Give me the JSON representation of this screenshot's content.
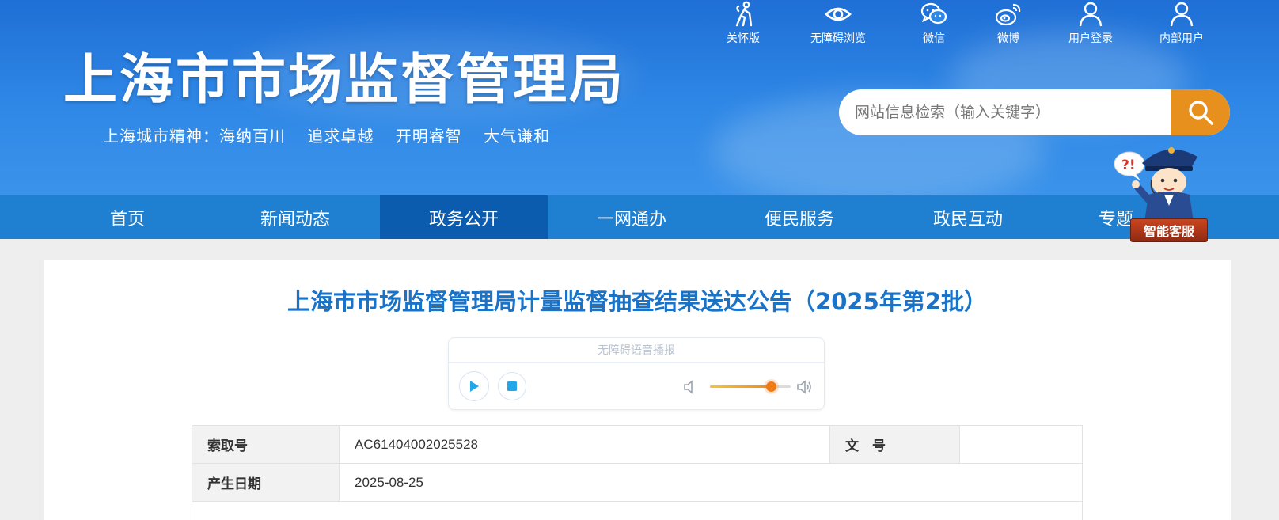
{
  "header": {
    "site_title": "上海市市场监督管理局",
    "slogan": "上海城市精神：海纳百川  追求卓越  开明睿智  大气谦和",
    "tools": [
      {
        "label": "关怀版",
        "icon": "elderly-care-icon"
      },
      {
        "label": "无障碍浏览",
        "icon": "eye-icon"
      },
      {
        "label": "微信",
        "icon": "wechat-icon"
      },
      {
        "label": "微博",
        "icon": "weibo-icon"
      },
      {
        "label": "用户登录",
        "icon": "user-icon"
      },
      {
        "label": "内部用户",
        "icon": "user-icon"
      }
    ],
    "search_placeholder": "网站信息检索（输入关键字）"
  },
  "nav": {
    "items": [
      "首页",
      "新闻动态",
      "政务公开",
      "一网通办",
      "便民服务",
      "政民互动",
      "专题"
    ],
    "active_index": 2
  },
  "assistant": {
    "label": "智能客服",
    "bubble": "?!"
  },
  "article": {
    "title": "上海市市场监督管理局计量监督抽查结果送达公告（2025年第2批）"
  },
  "player": {
    "title": "无障碍语音播报",
    "volume_fraction": 0.75,
    "colors": {
      "play": "#22a7e8",
      "accent": "#f07a18"
    }
  },
  "info": {
    "index_label": "索取号",
    "index_value": "AC61404002025528",
    "doc_no_label": "文　号",
    "doc_no_value": "",
    "date_label": "产生日期",
    "date_value": "2025-08-25"
  },
  "colors": {
    "brand": "#1f7fd1",
    "nav_active": "#0b5cae",
    "title": "#1a73c7",
    "search_button": "#e8901e"
  }
}
